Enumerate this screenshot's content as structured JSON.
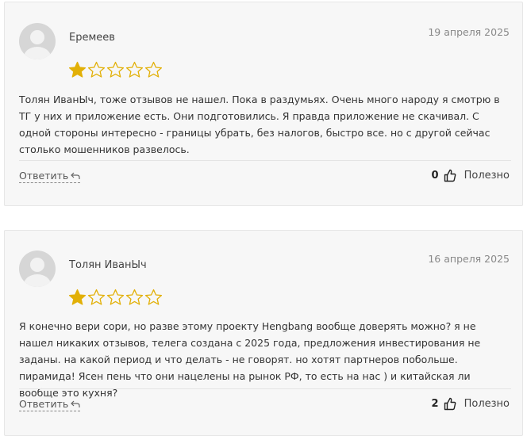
{
  "colors": {
    "card_bg": "#f7f7f7",
    "star_filled": "#e2b007",
    "star_outline": "#e2b007",
    "text": "#333333",
    "muted": "#888888"
  },
  "reviews": [
    {
      "author": "Еремеев",
      "date": "19 апреля 2025",
      "rating": 1,
      "max_rating": 5,
      "text": "Толян ИванЫч, тоже отзывов не нашел. Пока в раздумьях. Очень много народу я смотрю в ТГ у них и приложение есть. Они подготовились. Я правда приложение не скачивал. С одной стороны интересно - границы убрать, без налогов, быстро все. но с другой сейчас столько мошенников развелось.",
      "reply_label": "Ответить",
      "helpful_count": "0",
      "helpful_label": "Полезно"
    },
    {
      "author": "Толян ИванЫч",
      "date": "16 апреля 2025",
      "rating": 1,
      "max_rating": 5,
      "text": "Я конечно вери сори, но разве этому проекту Hengbang вообще доверять можно? я не нашел никаких отзывов, телега создана с 2025 года, предложения инвестирования не заданы. на какой период и что делать - не говорят. но хотят партнеров побольше. пирамида! Ясен пень что они нацелены на рынок РФ, то есть на нас ) и китайская ли вообще это кухня?",
      "reply_label": "Ответить",
      "helpful_count": "2",
      "helpful_label": "Полезно"
    }
  ]
}
